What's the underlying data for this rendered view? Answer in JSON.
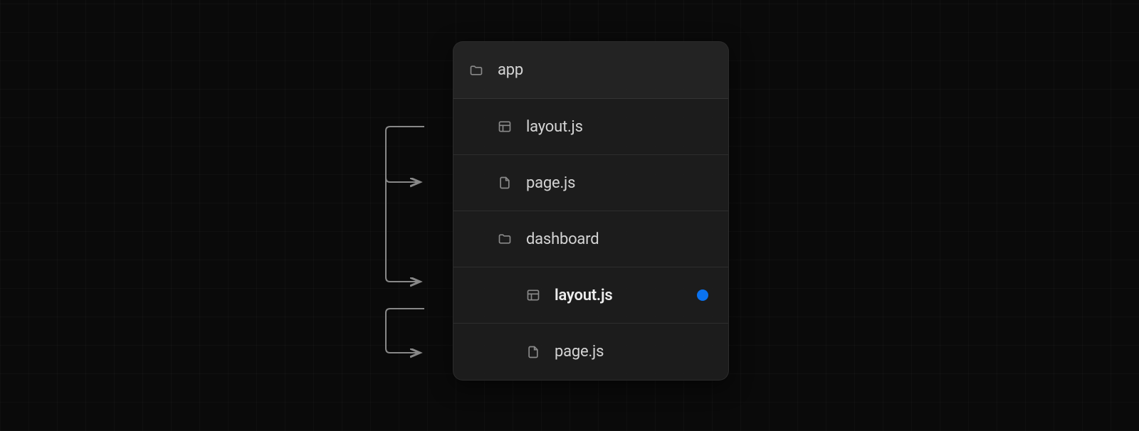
{
  "tree": {
    "root": {
      "label": "app"
    },
    "items": [
      {
        "label": "layout.js",
        "icon": "layout",
        "indent": 1,
        "bold": false,
        "dot": false
      },
      {
        "label": "page.js",
        "icon": "file",
        "indent": 1,
        "bold": false,
        "dot": false
      },
      {
        "label": "dashboard",
        "icon": "folder",
        "indent": 1,
        "bold": false,
        "dot": false
      },
      {
        "label": "layout.js",
        "icon": "layout",
        "indent": 2,
        "bold": true,
        "dot": true
      },
      {
        "label": "page.js",
        "icon": "file",
        "indent": 2,
        "bold": false,
        "dot": false
      }
    ]
  },
  "colors": {
    "dot": "#0a72ef"
  }
}
